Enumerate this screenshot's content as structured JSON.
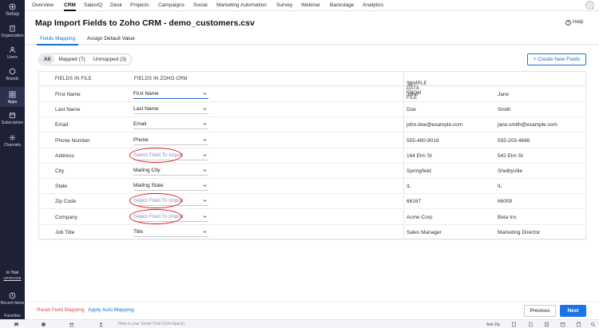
{
  "rail": {
    "setup": "Setup",
    "items": [
      {
        "label": "Organization",
        "icon": "organization-icon"
      },
      {
        "label": "Users",
        "icon": "users-icon"
      },
      {
        "label": "Brands",
        "icon": "brands-icon"
      },
      {
        "label": "Apps",
        "icon": "apps-icon"
      },
      {
        "label": "Subscription",
        "icon": "subscription-icon"
      },
      {
        "label": "Channels",
        "icon": "channels-icon"
      }
    ],
    "trial": "In Trial",
    "upgrade": "UPGRADE",
    "recent": "Recent Items",
    "favorites": "Favorites"
  },
  "topnav": {
    "tabs": [
      "Overview",
      "CRM",
      "SalesIQ",
      "Desk",
      "Projects",
      "Campaigns",
      "Social",
      "Marketing Automation",
      "Survey",
      "Webinar",
      "Backstage",
      "Analytics"
    ],
    "active": "CRM"
  },
  "header": {
    "title": "Map Import Fields to Zoho CRM - demo_customers.csv",
    "help": "Help"
  },
  "subtabs": [
    "Fields Mapping",
    "Assign Default Value"
  ],
  "filters": [
    "All",
    "Mapped (7)",
    "Unmapped (3)"
  ],
  "create_button": "+ Create New Fields",
  "table": {
    "headers": [
      "FIELDS IN FILE",
      "FIELDS IN ZOHO CRM",
      "SAMPLE DATA FROM FILE"
    ],
    "rows": [
      {
        "file": "First Name",
        "crm": "First Name",
        "s1": "John",
        "s2": "Jane"
      },
      {
        "file": "Last Name",
        "crm": "Last Name",
        "s1": "Doe",
        "s2": "Smith"
      },
      {
        "file": "Email",
        "crm": "Email",
        "s1": "john.doe@example.com",
        "s2": "jane.smith@example.com"
      },
      {
        "file": "Phone Number",
        "crm": "Phone",
        "s1": "555-480-9019",
        "s2": "555-203-4666"
      },
      {
        "file": "Address",
        "crm": "Select Field To Import",
        "s1": "164 Elm St",
        "s2": "542 Elm St"
      },
      {
        "file": "City",
        "crm": "Mailing City",
        "s1": "Springfield",
        "s2": "Shelbyville"
      },
      {
        "file": "State",
        "crm": "Mailing State",
        "s1": "IL",
        "s2": "IL"
      },
      {
        "file": "Zip Code",
        "crm": "Select Field To Import",
        "s1": "66167",
        "s2": "66009"
      },
      {
        "file": "Company",
        "crm": "Select Field To Import",
        "s1": "Acme Corp",
        "s2": "Beta Inc"
      },
      {
        "file": "Job Title",
        "crm": "Title",
        "s1": "Sales Manager",
        "s2": "Marketing Director"
      }
    ]
  },
  "footer": {
    "reset": "Reset Field Mapping",
    "auto": "Apply Auto Mapping",
    "previous": "Previous",
    "next": "Next"
  },
  "bottombar": {
    "smartchat": "Here is your Smart Chat (Ctrl+Space)",
    "askzia": "Ask Zia"
  },
  "colors": {
    "accent": "#1a73e8",
    "rail": "#1e2033",
    "annotation_circle": "#e0181b",
    "reset": "#e0484b",
    "placeholder": "#8a91b4"
  }
}
